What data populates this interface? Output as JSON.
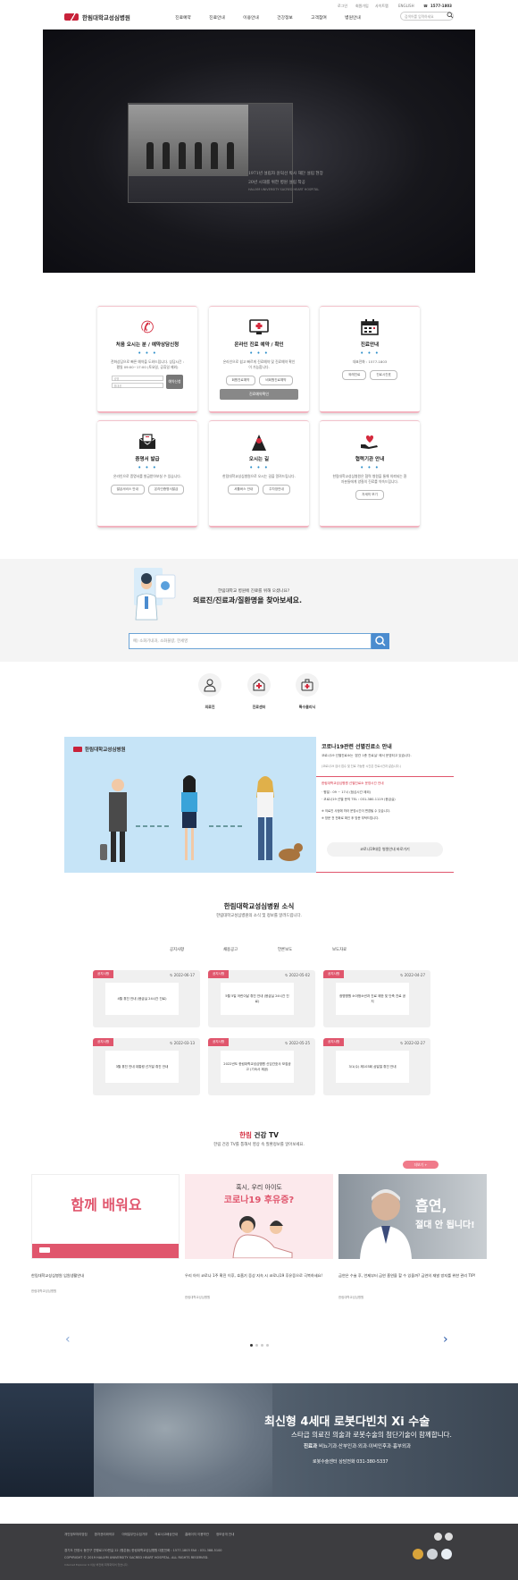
{
  "header": {
    "util_links": [
      "로그인",
      "회원가입",
      "사이트맵"
    ],
    "language": "ENGLISH",
    "phone": "1577-1803",
    "logo_text": "한림대학교성심병원",
    "nav": [
      "진료예약",
      "진료안내",
      "이용안내",
      "건강정보",
      "고객참여",
      "병원안내"
    ],
    "search_placeholder": "검색어를 입력하세요"
  },
  "hero": {
    "caption1": "1971년 설립자 윤덕선 박사 재단 설립 현장",
    "caption2": "20년 시대를 위한 병원 설립 착공",
    "caption3": "HALLYM UNIVERSITY SACRED HEART HOSPITAL"
  },
  "cards": [
    {
      "title": "처음 오시는 분 / 예약상담신청",
      "desc": "전화상담으로 빠른 예약을 도와드립니다. 상담시간 : 평일 09:00~17:00 (토요일, 공휴일 제외)",
      "input1": "성명",
      "input2": "휴대폰",
      "button": "예약신청"
    },
    {
      "title": "온라인 진료 예약 / 확인",
      "desc": "온라인으로 쉽고 빠르게 진료예약 및 진료예약 확인이 가능합니다.",
      "button1": "회원진료예약",
      "button2": "비회원진료예약",
      "button3": "진료예약확인"
    },
    {
      "title": "진료안내",
      "desc": "대표전화 : 1577-1803",
      "button1": "외래진료",
      "button2": "진료시간표"
    },
    {
      "title": "증명서 발급",
      "desc": "온라인으로 증명서를 발급받아보실 수 있습니다.",
      "button1": "발급서비스 안내",
      "button2": "온라인증명서발급"
    },
    {
      "title": "오시는 길",
      "desc": "한림대학교성심병원으로 오시는 길을 알려드립니다.",
      "button1": "셔틀버스 안내",
      "button2": "주차장안내"
    },
    {
      "title": "협력기관 안내",
      "desc": "한림대학교성심병원은 협력 병원을 통해 의뢰되는 환자분들에게 양질의 진료를 약속드립니다.",
      "button1": "자세히 보기"
    }
  ],
  "find": {
    "question": "한림대학교 병원에 진료를 위해 오셨나요?",
    "headline": "의료진/진료과/질환명을 찾아보세요.",
    "search_placeholder": "예) 소화기내과, 소화불량, 한세영",
    "quick": [
      "의료진",
      "진료센터",
      "특수클리닉"
    ]
  },
  "covid": {
    "logo_text": "한림대학교성심병원",
    "title": "코로나19관련 선별진료소 안내",
    "line1": "코로나19 선별진료소는 '본관 1층 진료실' 에서 운영되고 있습니다.",
    "line2": "(코로나19 검사 접수 및 진료 가능한 시간은 진료시간과 같습니다.)",
    "red1": "한림대학교성심병원 선별진료소 운영시간 안내",
    "time1": "· 평일 : 09 ~ 17시 (점심시간 제외)",
    "time2": "· 코로나19 선별 문의 TEL : 031-380-1119 (응급실)",
    "note1": "※ 의료진 사정에 따라 운영시간이 변경될 수 있습니다.",
    "note2": "※ 방문 전 전화로 확인 후 방문 부탁드립니다.",
    "button": "코로나19대응 병원안내 바로가기"
  },
  "news": {
    "title": "한림대학교성심병원 소식",
    "subtitle": "한림대학교성심병원의 소식 및 정보를 알려드립니다.",
    "tabs": [
      "공지사항",
      "채용공고",
      "언론보도",
      "보도자료"
    ],
    "items": [
      {
        "tag": "공지사항",
        "date": "2022-06-17",
        "text": "4월 휴진 안내 (응급실 24시간 진료)"
      },
      {
        "tag": "공지사항",
        "date": "2022-05-02",
        "text": "5월 5일 어린이날 휴진 안내 (응급실 24시간 진료)"
      },
      {
        "tag": "공지사항",
        "date": "2022-04-27",
        "text": "광명병원 소아청소년과 진료 제한 및 단축 진료 공지"
      },
      {
        "tag": "공지사항",
        "date": "2022-03-13",
        "text": "3월 휴진 안내 대통령 선거일 휴진 안내"
      },
      {
        "tag": "공지사항",
        "date": "2022-05-25",
        "text": "2022년도 한림대학교성심병원 신임간호사 모집공고 (기숙사 제공)"
      },
      {
        "tag": "공지사항",
        "date": "2022-02-27",
        "text": "3/1(수) 제103회 삼일절 휴진 안내"
      }
    ]
  },
  "tv": {
    "title_accent": "한림",
    "title_rest": "건강 TV",
    "subtitle": "한림 건강 TV를 통해서 영상 속 질환정보를 알아보세요.",
    "more": "더보기 +",
    "videos": [
      {
        "thumb1": "함께 배워요",
        "title": "한림대학교성심병원 입원생활안내",
        "source": "한림대학교성심병원"
      },
      {
        "thumb1": "혹시, 우리 아이도",
        "thumb2": "코로나19 후유증?",
        "title": "우리 아이 코로나 1주 확진 이후, 호흡기 증상 지속 시 코로나19 후유증으로 극복하세요!",
        "source": "한림대학교성심병원"
      },
      {
        "thumb1": "흡연,",
        "thumb2": "절대 안 됩니다!",
        "title": "금연은 수술 후, 언제부터 금연 흡연을 할 수 있을까? 금연의 재발 방지를 위한 관리 TIP!",
        "source": "한림대학교성심병원"
      }
    ]
  },
  "banner": {
    "headline": "최신형 4세대 로봇다빈치 Xi 수술",
    "sub1": "스타급 의료진 의술과 로봇수술의 첨단기술이 함께합니다.",
    "sub2_bold": "진료과",
    "sub2": "비뇨기과·산부인과·외과·이비인후과·흉부외과",
    "contact": "로봇수술센터 상담전화 031-380-5337"
  },
  "footer": {
    "links": [
      "개인정보처리방침",
      "환자권리와의무",
      "이메일무단수집거부",
      "의료사고배상안내",
      "홈페이지 이용약관",
      "정보공개 안내"
    ],
    "address": "경기도 안양시 동안구 관평로170번길 22 (평촌동) 한림대학교성심병원 대표전화 : 1577-1803  FAX : 031-388-5100",
    "copyright": "COPYRIGHT © 2019 HALLYM UNIVERSITY SACRED HEART HOSPITAL. ALL RIGHTS RESERVED.",
    "note": "Internet Explorer 9 이상 버전에 최적화되어 있습니다."
  }
}
